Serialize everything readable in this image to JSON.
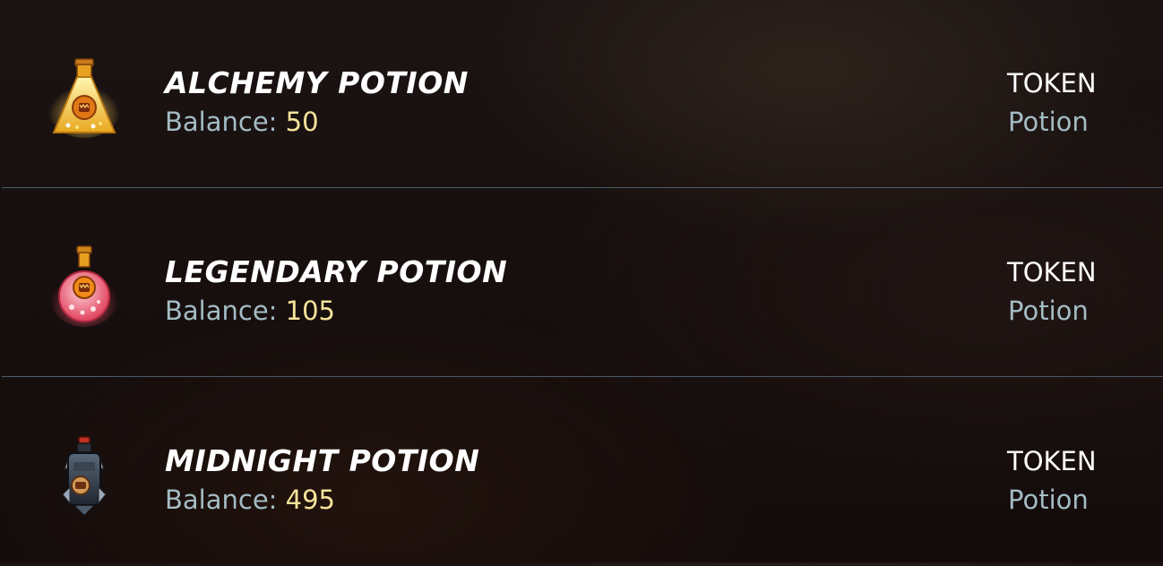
{
  "items": [
    {
      "name": "ALCHEMY POTION",
      "balance_label": "Balance:",
      "balance_value": "50",
      "type": "TOKEN",
      "subtype": "Potion",
      "icon": "alchemy-potion-icon"
    },
    {
      "name": "LEGENDARY POTION",
      "balance_label": "Balance:",
      "balance_value": "105",
      "type": "TOKEN",
      "subtype": "Potion",
      "icon": "legendary-potion-icon"
    },
    {
      "name": "MIDNIGHT POTION",
      "balance_label": "Balance:",
      "balance_value": "495",
      "type": "TOKEN",
      "subtype": "Potion",
      "icon": "midnight-potion-icon"
    }
  ],
  "colors": {
    "name": "#ffffff",
    "balance_label": "#a4bcc4",
    "balance_value": "#f5e39a",
    "type": "#ffffff",
    "subtype": "#a4bcc4",
    "divider": "#4d5c66"
  }
}
